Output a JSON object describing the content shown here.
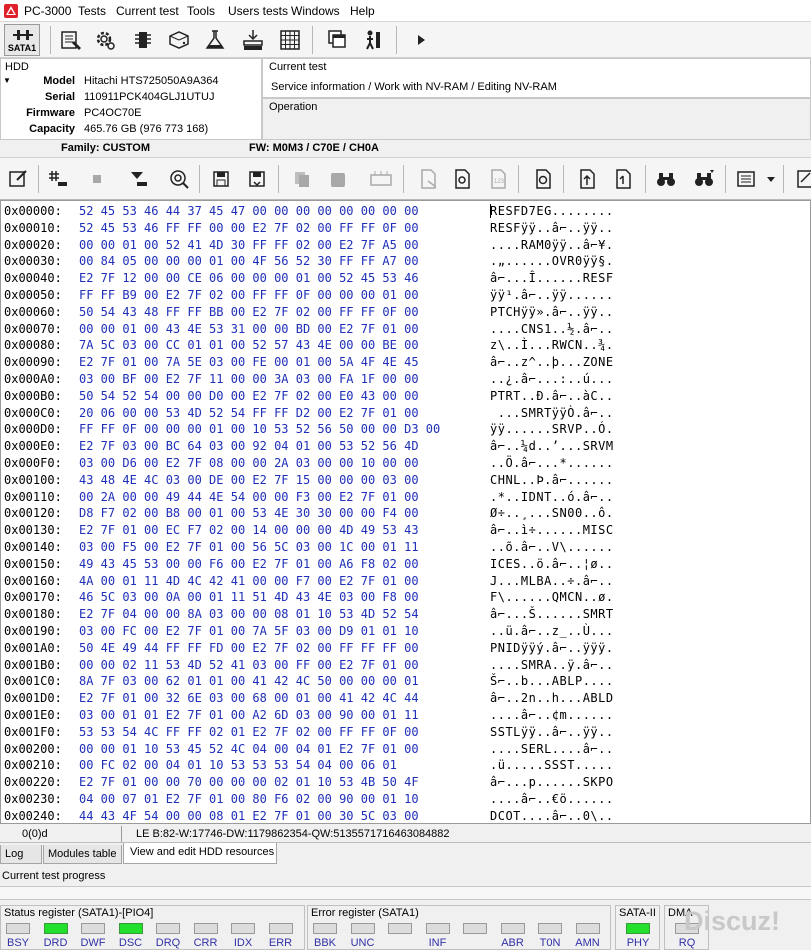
{
  "title_bar": {
    "app_name": "PC-3000"
  },
  "menu": [
    "Tests",
    "Current test",
    "Tools",
    "Users tests",
    "Windows",
    "Help"
  ],
  "toolbar1": {
    "sata_label": "SATA1"
  },
  "hdd": {
    "section_title": "HDD",
    "fields": [
      {
        "label": "Model",
        "value": "Hitachi HTS725050A9A364"
      },
      {
        "label": "Serial",
        "value": "110911PCK404GLJ1UTUJ"
      },
      {
        "label": "Firmware",
        "value": "PC4OC70E"
      },
      {
        "label": "Capacity",
        "value": "465.76 GB (976 773 168)"
      }
    ],
    "family": "Family: CUSTOM",
    "fw": "FW: M0M3 / C70E / CH0A"
  },
  "current_test": {
    "title": "Current test",
    "value": "Service information / Work with NV-RAM / Editing NV-RAM"
  },
  "operation": {
    "title": "Operation"
  },
  "hex_rows": [
    {
      "addr": "0x00000:",
      "bytes": "52 45 53 46 44 37 45 47 00 00 00 00 00 00 00 00",
      "ascii": "RESFD7EG........"
    },
    {
      "addr": "0x00010:",
      "bytes": "52 45 53 46 FF FF 00 00 E2 7F 02 00 FF FF 0F 00",
      "ascii": "RESFÿÿ..â⌐..ÿÿ.."
    },
    {
      "addr": "0x00020:",
      "bytes": "00 00 01 00 52 41 4D 30 FF FF 02 00 E2 7F A5 00",
      "ascii": "....RAM0ÿÿ..â⌐¥."
    },
    {
      "addr": "0x00030:",
      "bytes": "00 84 05 00 00 00 01 00 4F 56 52 30 FF FF A7 00",
      "ascii": ".„......OVR0ÿÿ§."
    },
    {
      "addr": "0x00040:",
      "bytes": "E2 7F 12 00 00 CE 06 00 00 00 01 00 52 45 53 46",
      "ascii": "â⌐...Î......RESF"
    },
    {
      "addr": "0x00050:",
      "bytes": "FF FF B9 00 E2 7F 02 00 FF FF 0F 00 00 00 01 00",
      "ascii": "ÿÿ¹.â⌐..ÿÿ......"
    },
    {
      "addr": "0x00060:",
      "bytes": "50 54 43 48 FF FF BB 00 E2 7F 02 00 FF FF 0F 00",
      "ascii": "PTCHÿÿ».â⌐..ÿÿ.."
    },
    {
      "addr": "0x00070:",
      "bytes": "00 00 01 00 43 4E 53 31 00 00 BD 00 E2 7F 01 00",
      "ascii": "....CNS1..½.â⌐.."
    },
    {
      "addr": "0x00080:",
      "bytes": "7A 5C 03 00 CC 01 01 00 52 57 43 4E 00 00 BE 00",
      "ascii": "z\\..Ì...RWCN..¾."
    },
    {
      "addr": "0x00090:",
      "bytes": "E2 7F 01 00 7A 5E 03 00 FE 00 01 00 5A 4F 4E 45",
      "ascii": "â⌐..z^..þ...ZONE"
    },
    {
      "addr": "0x000A0:",
      "bytes": "03 00 BF 00 E2 7F 11 00 00 3A 03 00 FA 1F 00 00",
      "ascii": "..¿.â⌐...:..ú..."
    },
    {
      "addr": "0x000B0:",
      "bytes": "50 54 52 54 00 00 D0 00 E2 7F 02 00 E0 43 00 00",
      "ascii": "PTRT..Ð.â⌐..àC.."
    },
    {
      "addr": "0x000C0:",
      "bytes": "20 06 00 00 53 4D 52 54 FF FF D2 00 E2 7F 01 00",
      "ascii": " ...SMRTÿÿÒ.â⌐.."
    },
    {
      "addr": "0x000D0:",
      "bytes": "FF FF 0F 00 00 00 01 00 10 53 52 56 50 00 00 D3 00",
      "ascii": "ÿÿ......SRVP..Ó."
    },
    {
      "addr": "0x000E0:",
      "bytes": "E2 7F 03 00 BC 64 03 00 92 04 01 00 53 52 56 4D",
      "ascii": "â⌐..¼d..’...SRVM"
    },
    {
      "addr": "0x000F0:",
      "bytes": "03 00 D6 00 E2 7F 08 00 00 2A 03 00 00 10 00 00",
      "ascii": "..Ö.â⌐...*......"
    },
    {
      "addr": "0x00100:",
      "bytes": "43 48 4E 4C 03 00 DE 00 E2 7F 15 00 00 00 03 00",
      "ascii": "CHNL..Þ.â⌐......"
    },
    {
      "addr": "0x00110:",
      "bytes": "00 2A 00 00 49 44 4E 54 00 00 F3 00 E2 7F 01 00",
      "ascii": ".*..IDNT..ó.â⌐.."
    },
    {
      "addr": "0x00120:",
      "bytes": "D8 F7 02 00 B8 00 01 00 53 4E 30 30 00 00 F4 00",
      "ascii": "Ø÷..¸...SN00..ô."
    },
    {
      "addr": "0x00130:",
      "bytes": "E2 7F 01 00 EC F7 02 00 14 00 00 00 4D 49 53 43",
      "ascii": "â⌐..ì÷......MISC"
    },
    {
      "addr": "0x00140:",
      "bytes": "03 00 F5 00 E2 7F 01 00 56 5C 03 00 1C 00 01 11",
      "ascii": "..õ.â⌐..V\\......"
    },
    {
      "addr": "0x00150:",
      "bytes": "49 43 45 53 00 00 F6 00 E2 7F 01 00 A6 F8 02 00",
      "ascii": "ICES..ö.â⌐..¦ø.."
    },
    {
      "addr": "0x00160:",
      "bytes": "4A 00 01 11 4D 4C 42 41 00 00 F7 00 E2 7F 01 00",
      "ascii": "J...MLBA..÷.â⌐.."
    },
    {
      "addr": "0x00170:",
      "bytes": "46 5C 03 00 0A 00 01 11 51 4D 43 4E 03 00 F8 00",
      "ascii": "F\\......QMCN..ø."
    },
    {
      "addr": "0x00180:",
      "bytes": "E2 7F 04 00 00 8A 03 00 00 08 01 10 53 4D 52 54",
      "ascii": "â⌐...Š......SMRT"
    },
    {
      "addr": "0x00190:",
      "bytes": "03 00 FC 00 E2 7F 01 00 7A 5F 03 00 D9 01 01 10",
      "ascii": "..ü.â⌐..z_..Ù..."
    },
    {
      "addr": "0x001A0:",
      "bytes": "50 4E 49 44 FF FF FD 00 E2 7F 02 00 FF FF FF 00",
      "ascii": "PNIDÿÿý.â⌐..ÿÿÿ."
    },
    {
      "addr": "0x001B0:",
      "bytes": "00 00 02 11 53 4D 52 41 03 00 FF 00 E2 7F 01 00",
      "ascii": "....SMRA..ÿ.â⌐.."
    },
    {
      "addr": "0x001C0:",
      "bytes": "8A 7F 03 00 62 01 01 00 41 42 4C 50 00 00 00 01",
      "ascii": "Š⌐..b...ABLP...."
    },
    {
      "addr": "0x001D0:",
      "bytes": "E2 7F 01 00 32 6E 03 00 68 00 01 00 41 42 4C 44",
      "ascii": "â⌐..2n..h...ABLD"
    },
    {
      "addr": "0x001E0:",
      "bytes": "03 00 01 01 E2 7F 01 00 A2 6D 03 00 90 00 01 11",
      "ascii": "....â⌐..¢m......"
    },
    {
      "addr": "0x001F0:",
      "bytes": "53 53 54 4C FF FF 02 01 E2 7F 02 00 FF FF 0F 00",
      "ascii": "SSTLÿÿ..â⌐..ÿÿ.."
    },
    {
      "addr": "0x00200:",
      "bytes": "00 00 01 10 53 45 52 4C 04 00 04 01 E2 7F 01 00",
      "ascii": "....SERL....â⌐.."
    },
    {
      "addr": "0x00210:",
      "bytes": "00 FC 02 00 04 01 10 53 53 53 54 04 00 06 01",
      "ascii": ".ü.....SSST....."
    },
    {
      "addr": "0x00220:",
      "bytes": "E2 7F 01 00 00 70 00 00 00 02 01 10 53 4B 50 4F",
      "ascii": "â⌐...p......SKPO"
    },
    {
      "addr": "0x00230:",
      "bytes": "04 00 07 01 E2 7F 01 00 80 F6 02 00 90 00 01 10",
      "ascii": "....â⌐..€ö......"
    },
    {
      "addr": "0x00240:",
      "bytes": "44 43 4F 54 00 00 08 01 E2 7F 01 00 30 5C 03 00",
      "ascii": "DCOT....â⌐..0\\.."
    }
  ],
  "status_line": {
    "position": "0(0)d",
    "value_info": "LE B:82-W:17746-DW:1179862354-QW:5135571716463084882"
  },
  "tabs": [
    "Log",
    "Modules table",
    "View and edit HDD resources"
  ],
  "progress": {
    "label": "Current test progress"
  },
  "status_register": {
    "title": "Status register (SATA1)-[PIO4]",
    "leds": [
      {
        "name": "BSY",
        "on": false
      },
      {
        "name": "DRD",
        "on": true
      },
      {
        "name": "DWF",
        "on": false
      },
      {
        "name": "DSC",
        "on": true
      },
      {
        "name": "DRQ",
        "on": false
      },
      {
        "name": "CRR",
        "on": false
      },
      {
        "name": "IDX",
        "on": false
      },
      {
        "name": "ERR",
        "on": false
      }
    ]
  },
  "error_register": {
    "title": "Error register (SATA1)",
    "leds": [
      {
        "name": "BBK",
        "on": false
      },
      {
        "name": "UNC",
        "on": false
      },
      {
        "name": "",
        "on": false
      },
      {
        "name": "INF",
        "on": false
      },
      {
        "name": "",
        "on": false
      },
      {
        "name": "ABR",
        "on": false
      },
      {
        "name": "T0N",
        "on": false
      },
      {
        "name": "AMN",
        "on": false
      }
    ]
  },
  "sata2": {
    "title": "SATA-II",
    "led": {
      "name": "PHY",
      "on": true
    }
  },
  "dma": {
    "title": "DMA",
    "led": {
      "name": "RQ",
      "on": false
    }
  },
  "watermark": "Discuz!",
  "colors": {
    "hex_bytes": "#1f2fb8",
    "led_on": "#22e02c",
    "logo": "#e0202a"
  },
  "icons": {
    "toolbar1": [
      "sata-port-icon",
      "hdd-tool-icon",
      "gear-icon",
      "chip-icon",
      "hdd-icon",
      "flask-icon",
      "hdd-stack-icon",
      "grid-icon",
      "windows-icon",
      "person-icon",
      "play-icon"
    ],
    "toolbar2": [
      "edit-icon",
      "bookmark-icon",
      "stop-icon",
      "download-icon",
      "refresh-icon",
      "save-icon",
      "save-as-icon",
      "copy-icon",
      "paste-icon",
      "compare-icon",
      "page-icon",
      "page-edit-icon",
      "counter-icon",
      "page-refresh-icon",
      "upload-icon",
      "download-file-icon",
      "binoculars-icon",
      "binoculars-next-icon",
      "checklist-icon",
      "dropdown-icon",
      "note-icon"
    ]
  }
}
